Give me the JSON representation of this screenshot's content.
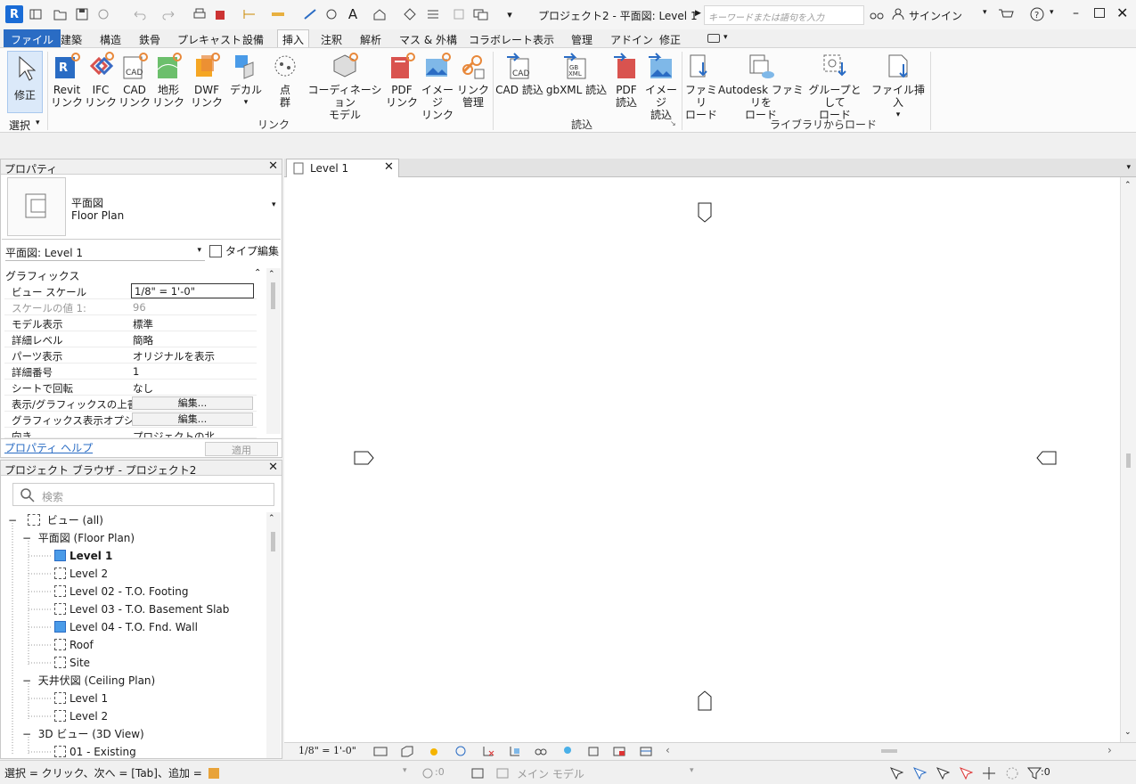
{
  "app": {
    "logo": "R",
    "title": "プロジェクト2 - 平面図: Level 1",
    "search_placeholder": "キーワードまたは語句を入力",
    "signin": "サインイン"
  },
  "tabs": [
    "ファイル",
    "建築",
    "構造",
    "鉄骨",
    "プレキャスト",
    "設備",
    "挿入",
    "注釈",
    "解析",
    "マス & 外構",
    "コラボレート",
    "表示",
    "管理",
    "アドイン",
    "修正"
  ],
  "ribbon": {
    "modify_label": "修正",
    "select_label": "選択",
    "link_panel_label": "リンク",
    "import_panel_label": "読込",
    "library_panel_label": "ライブラリからロード",
    "buttons": {
      "revit_link": [
        "Revit",
        "リンク"
      ],
      "ifc_link": [
        "IFC",
        "リンク"
      ],
      "cad_link": [
        "CAD",
        "リンク"
      ],
      "topo_link": [
        "地形",
        "リンク"
      ],
      "dwf_link": [
        "DWF",
        "リンク"
      ],
      "decal": [
        "デカル",
        ""
      ],
      "point_cloud": [
        "点",
        "群"
      ],
      "coordination_model": [
        "コーディネーション",
        "モデル"
      ],
      "pdf_link": [
        "PDF",
        "リンク"
      ],
      "image_link": [
        "イメージ",
        "リンク"
      ],
      "manage_links": [
        "リンク",
        "管理"
      ],
      "cad_import": [
        "CAD 読込",
        ""
      ],
      "gbxml_import": [
        "gbXML 読込",
        ""
      ],
      "pdf_import": [
        "PDF",
        "読込"
      ],
      "image_import": [
        "イメージ",
        "読込"
      ],
      "load_family": [
        "ファミリ",
        "ロード"
      ],
      "autodesk_family": [
        "Autodesk ファミリを",
        "ロード"
      ],
      "load_as_group": [
        "グループとして",
        "ロード"
      ],
      "insert_from_file": [
        "ファイル挿入",
        ""
      ]
    }
  },
  "properties": {
    "header": "プロパティ",
    "type_line1": "平面図",
    "type_line2": "Floor Plan",
    "instance_selector": "平面図: Level 1",
    "edit_type": "タイプ編集",
    "group": "グラフィックス",
    "rows": [
      {
        "k": "ビュー スケール",
        "v": "1/8\" = 1'-0\""
      },
      {
        "k": "スケールの値    1:",
        "v": "96"
      },
      {
        "k": "モデル表示",
        "v": "標準"
      },
      {
        "k": "詳細レベル",
        "v": "簡略"
      },
      {
        "k": "パーツ表示",
        "v": "オリジナルを表示"
      },
      {
        "k": "詳細番号",
        "v": "1"
      },
      {
        "k": "シートで回転",
        "v": "なし"
      },
      {
        "k": "表示/グラフィックスの上書き",
        "v": "編集..."
      },
      {
        "k": "グラフィックス表示オプション",
        "v": "編集..."
      },
      {
        "k": "向き",
        "v": "プロジェクトの北"
      }
    ],
    "help_link": "プロパティ ヘルプ",
    "apply": "適用"
  },
  "browser": {
    "header": "プロジェクト ブラウザ - プロジェクト2",
    "search_placeholder": "検索",
    "root": "ビュー (all)",
    "floor_plan_group": "平面図 (Floor Plan)",
    "floor_plans": [
      "Level 1",
      "Level 2",
      "Level 02 - T.O. Footing",
      "Level 03 - T.O. Basement Slab",
      "Level 04 - T.O. Fnd. Wall",
      "Roof",
      "Site"
    ],
    "ceiling_group": "天井伏図 (Ceiling Plan)",
    "ceiling_plans": [
      "Level 1",
      "Level 2"
    ],
    "view3d_group": "3D ビュー (3D View)",
    "views3d": [
      "01 - Existing"
    ]
  },
  "document": {
    "tab_label": "Level 1",
    "view_scale": "1/8\" = 1'-0\""
  },
  "status": {
    "hint": "選択 = クリック、次へ = [Tab]、追加 = [Ctrl]、選",
    "workset_count": ":0",
    "main_model": "メイン モデル",
    "filter_count": ":0"
  },
  "colors": {
    "accent": "#2a6cc4",
    "link_orange": "#e8883a",
    "selected_view": "#4a9be8"
  }
}
